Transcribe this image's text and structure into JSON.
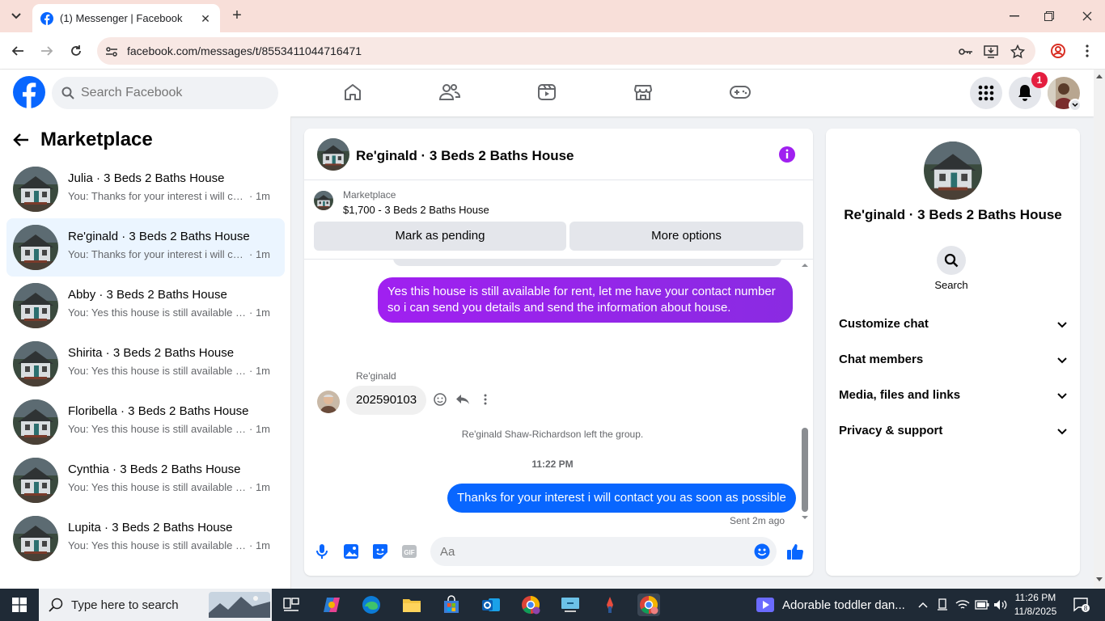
{
  "browser": {
    "tab_title": "(1) Messenger | Facebook",
    "url": "facebook.com/messages/t/8553411044716471"
  },
  "fb_header": {
    "search_placeholder": "Search Facebook",
    "notification_count": "1",
    "nav_icons": [
      "home-icon",
      "friends-icon",
      "video-icon",
      "marketplace-icon",
      "gaming-icon"
    ]
  },
  "sidebar": {
    "title": "Marketplace",
    "conversations": [
      {
        "name": "Julia · 3 Beds 2 Baths House",
        "preview": "You: Thanks for your interest i will contact you as soon as possible",
        "time": "· 1m",
        "active": false
      },
      {
        "name": "Re'ginald · 3 Beds 2 Baths House",
        "preview": "You: Thanks for your interest i will contact you as soon as possible",
        "time": "· 1m",
        "active": true
      },
      {
        "name": "Abby · 3 Beds 2 Baths House",
        "preview": "You: Yes this house is still available for rent",
        "time": "· 1m",
        "active": false
      },
      {
        "name": "Shirita · 3 Beds 2 Baths House",
        "preview": "You: Yes this house is still available for rent",
        "time": "· 1m",
        "active": false
      },
      {
        "name": "Floribella · 3 Beds 2 Baths House",
        "preview": "You: Yes this house is still available for rent",
        "time": "· 1m",
        "active": false
      },
      {
        "name": "Cynthia · 3 Beds 2 Baths House",
        "preview": "You: Yes this house is still available for rent",
        "time": "· 1m",
        "active": false
      },
      {
        "name": "Lupita · 3 Beds 2 Baths House",
        "preview": "You: Yes this house is still available for rent",
        "time": "· 1m",
        "active": false
      }
    ]
  },
  "chat": {
    "title": "Re'ginald · 3 Beds 2 Baths House",
    "marketplace_label": "Marketplace",
    "listing": "$1,700 - 3 Beds 2 Baths House",
    "mark_pending": "Mark as pending",
    "more_options": "More options",
    "messages": {
      "out1": "Yes this house is still available for rent, let me have your contact number so i can send you details and send the information about house.",
      "sender_name": "Re'ginald",
      "in1": "202590103",
      "system_note": "Re'ginald Shaw-Richardson left the group.",
      "time_divider": "11:22 PM",
      "out2": "Thanks for your interest i will contact you as soon as possible",
      "sent_status": "Sent 2m ago"
    },
    "composer_placeholder": "Aa"
  },
  "right_panel": {
    "name": "Re'ginald · 3 Beds 2 Baths House",
    "search_label": "Search",
    "sections": [
      "Customize chat",
      "Chat members",
      "Media, files and links",
      "Privacy & support"
    ]
  },
  "taskbar": {
    "search_placeholder": "Type here to search",
    "news": "Adorable toddler dan...",
    "time": "11:26 PM",
    "date": "11/8/2025",
    "notif_count": "8"
  },
  "colors": {
    "fb_blue": "#0866ff",
    "purple_bubble": "#a020f0",
    "active_conv": "#ebf5ff"
  }
}
